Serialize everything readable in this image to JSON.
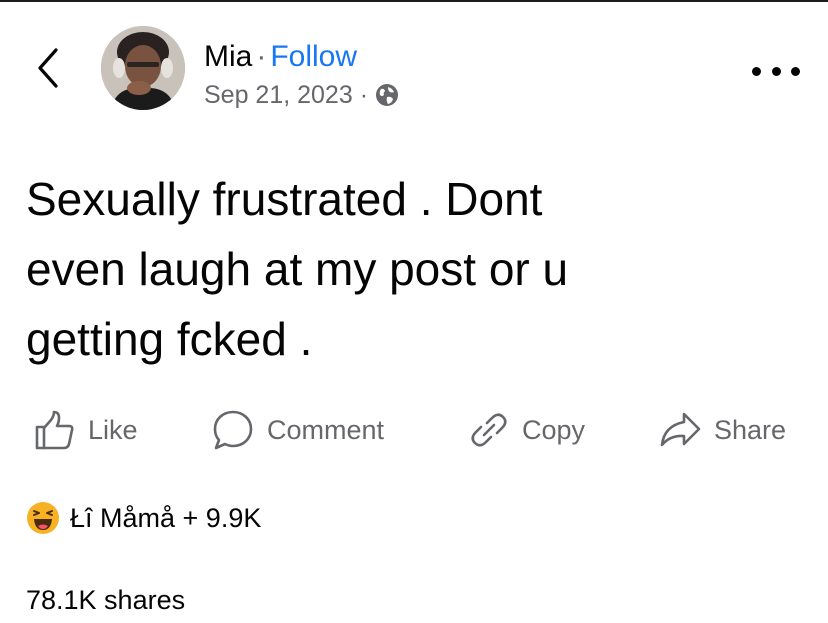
{
  "post": {
    "author_name": "Mia",
    "separator": "·",
    "follow_label": "Follow",
    "date": "Sep 21, 2023",
    "meta_separator": "·",
    "privacy_icon": "globe-icon",
    "text": "Sexually frustrated . Dont\neven laugh at my post or u\ngetting fcked ."
  },
  "actions": {
    "like_label": "Like",
    "comment_label": "Comment",
    "copy_label": "Copy",
    "share_label": "Share"
  },
  "reactions": {
    "emoji": "haha-reaction-icon",
    "summary": "Łî Måmå + 9.9K"
  },
  "shares": "78.1K shares",
  "colors": {
    "link_blue": "#1877f2",
    "secondary_text": "#65676b",
    "primary_text": "#050505",
    "haha_yellow": "#f7b125"
  }
}
